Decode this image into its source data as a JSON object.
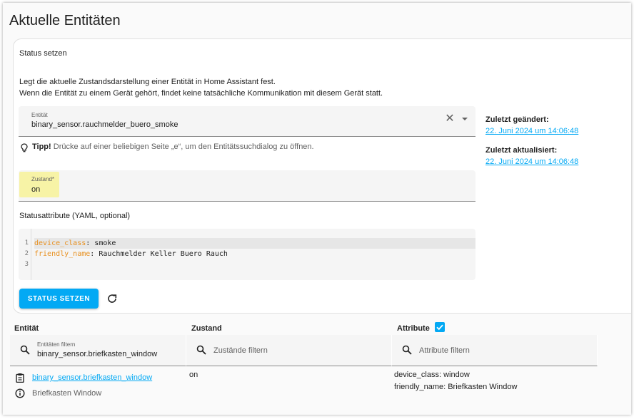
{
  "page": {
    "title": "Aktuelle Entitäten"
  },
  "form": {
    "title": "Status setzen",
    "description_line1": "Legt die aktuelle Zustandsdarstellung einer Entität in Home Assistant fest.",
    "description_line2": "Wenn die Entität zu einem Gerät gehört, findet keine tatsächliche Kommunikation mit diesem Gerät statt.",
    "entity_label": "Entität",
    "entity_value": "binary_sensor.rauchmelder_buero_smoke",
    "clear_glyph": "✕",
    "tip_bold": "Tipp!",
    "tip_text": " Drücke auf einer beliebigen Seite „e“, um den Entitätssuchdialog zu öffnen.",
    "state_label": "Zustand*",
    "state_value": "on",
    "attributes_label": "Statusattribute (YAML, optional)",
    "yaml": {
      "line_numbers": [
        "1",
        "2",
        "3"
      ],
      "lines": [
        {
          "key": "device_class",
          "sep": ": ",
          "value": "smoke"
        },
        {
          "key": "friendly_name",
          "sep": ": ",
          "value": "Rauchmelder Keller Buero Rauch"
        }
      ],
      "key_color": "#e8901f"
    },
    "submit_label": "STATUS SETZEN"
  },
  "sidebar": {
    "last_changed_label": "Zuletzt geändert:",
    "last_changed_value": "22. Juni 2024 um 14:06:48",
    "last_updated_label": "Zuletzt aktualisiert:",
    "last_updated_value": "22. Juni 2024 um 14:06:48"
  },
  "table": {
    "headers": {
      "entity": "Entität",
      "state": "Zustand",
      "attributes": "Attribute"
    },
    "attributes_checkbox_checked": true,
    "filters": {
      "entity_label": "Entitäten filtern",
      "entity_value": "binary_sensor.briefkasten_window",
      "state_placeholder": "Zustände filtern",
      "attributes_placeholder": "Attribute filtern"
    },
    "rows": [
      {
        "entity_id": "binary_sensor.briefkasten_window",
        "friendly_name": "Briefkasten Window",
        "state": "on",
        "attributes": [
          "device_class: window",
          "friendly_name: Briefkasten Window"
        ]
      }
    ]
  },
  "colors": {
    "accent": "#03a9f4",
    "highlight": "#f7f3a6",
    "field_bg": "#f5f5f5",
    "yaml_key": "#e8901f"
  },
  "icons": [
    "close-icon",
    "chevron-down-icon",
    "lightbulb-icon",
    "refresh-icon",
    "check-icon",
    "search-icon",
    "clipboard-icon",
    "info-icon"
  ]
}
